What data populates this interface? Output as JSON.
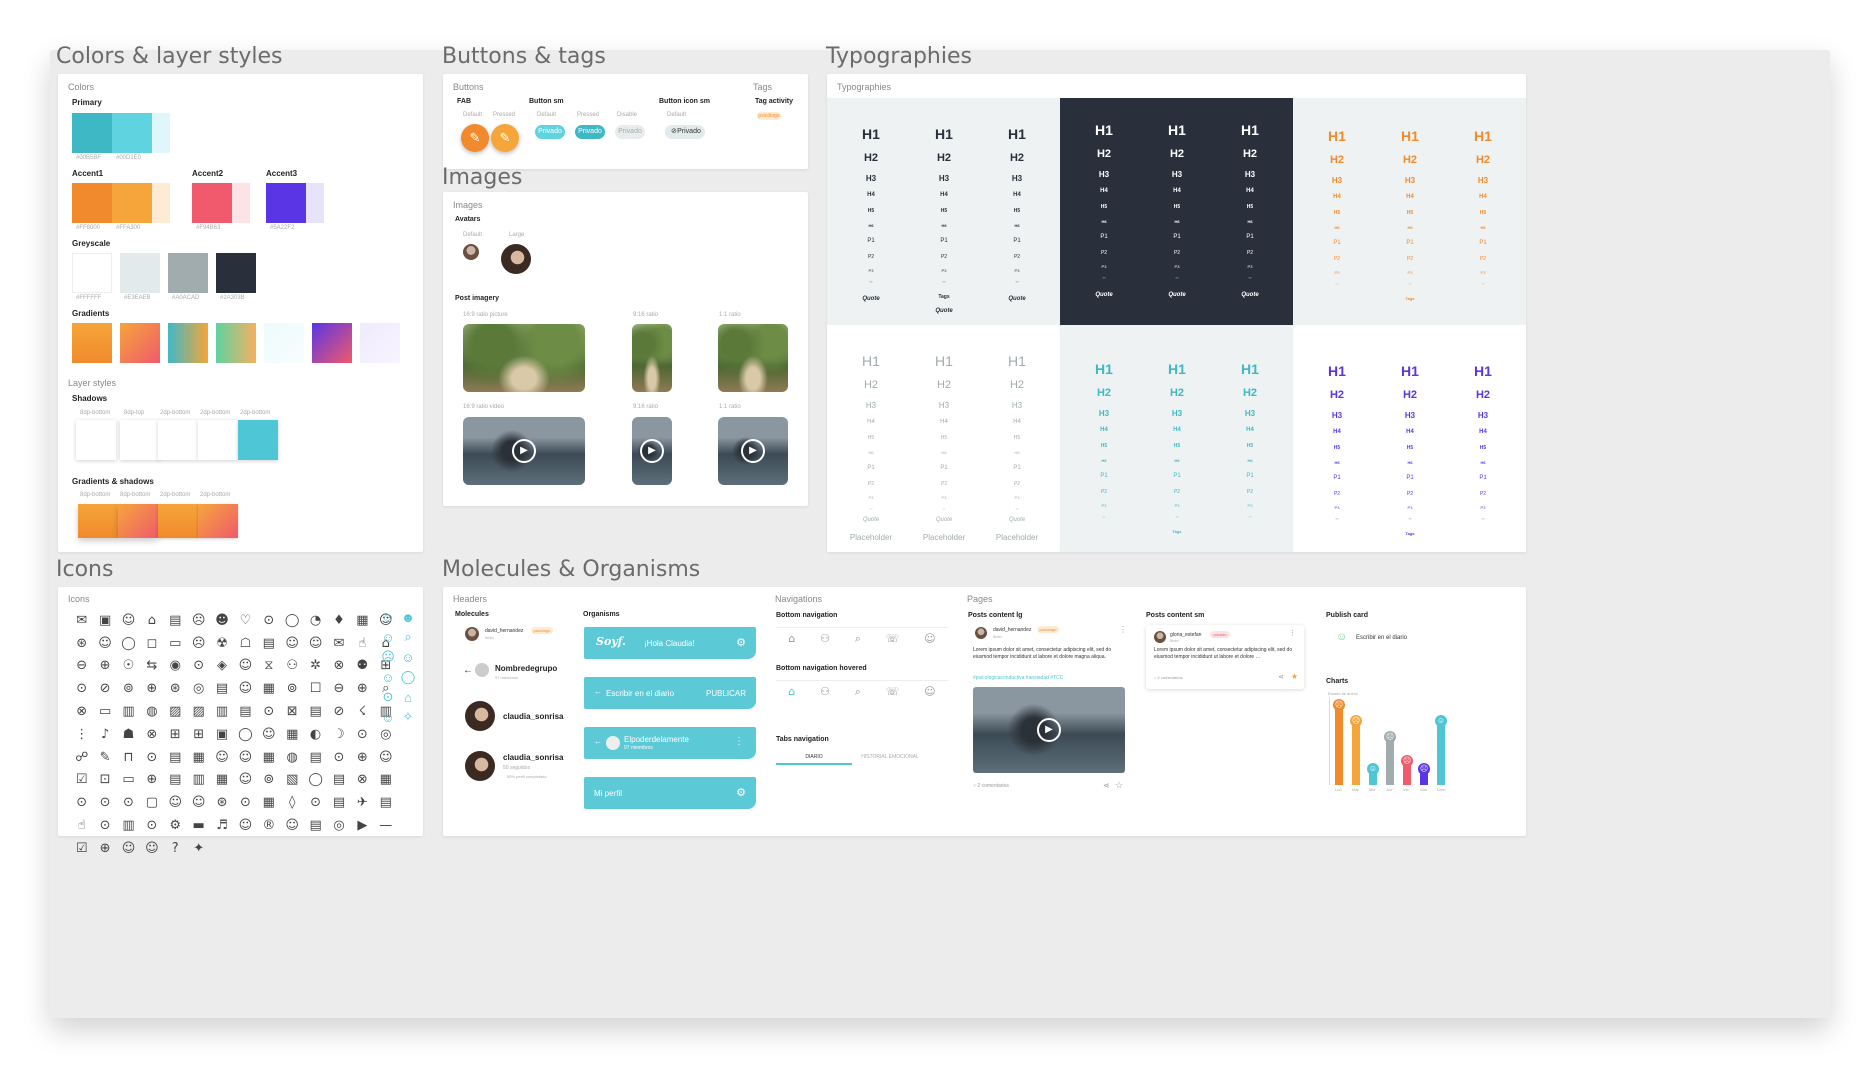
{
  "sections": {
    "colors": "Colors & layer styles",
    "buttons": "Buttons & tags",
    "images": "Images",
    "typographies": "Typographies",
    "icons": "Icons",
    "molecules": "Molecules & Organisms"
  },
  "colors": {
    "card_label": "Colors",
    "primary": "Primary",
    "primary_codes": [
      "#00B5BF",
      "#00D1E0"
    ],
    "accent1": "Accent1",
    "accent1_codes": [
      "#FF8000",
      "#FFA300"
    ],
    "accent2": "Accent2",
    "accent2_code": "#F94B63",
    "accent3": "Accent3",
    "accent3_code": "#5A22F2",
    "greyscale": "Greyscale",
    "grey_codes": [
      "#FFFFFF",
      "#E3EAEB",
      "#A0ACAD",
      "#2A303B"
    ],
    "gradients": "Gradients",
    "layer_styles": "Layer styles",
    "shadows": "Shadows",
    "shadow_labels": [
      "8dp-bottom",
      "8dp-top",
      "2dp-bottom",
      "2dp-bottom",
      "2dp-bottom"
    ],
    "grad_shadows": "Gradients & shadows",
    "grad_shadow_labels": [
      "8dp-bottom",
      "8dp-bottom",
      "2dp-bottom",
      "2dp-bottom"
    ],
    "swatch_colors": {
      "primary": [
        "#3fb8c6",
        "#5fd3e0",
        "#dff7fa"
      ],
      "accent1": [
        "#f08a2c",
        "#f5a53a",
        "#fdebd3"
      ],
      "accent2": [
        "#f05a6c",
        "#fde3e6"
      ],
      "accent3": [
        "#5a35e6",
        "#e7e3fb"
      ],
      "grey": [
        "#ffffff",
        "#e3eaeb",
        "#a0acad",
        "#2a303b"
      ]
    }
  },
  "buttons": {
    "card_label": "Buttons",
    "tags_label": "Tags",
    "fab": "FAB",
    "button_sm": "Button sm",
    "button_icon_sm": "Button icon sm",
    "tag_activity": "Tag activity",
    "states_fab": [
      "Default",
      "Pressed"
    ],
    "states_sm": [
      "Default",
      "Pressed",
      "Disable"
    ],
    "state_icon": "Default",
    "privado": "Privado",
    "tag_text": "psicólogo"
  },
  "images": {
    "card_label": "Images",
    "avatars": "Avatars",
    "avatar_states": [
      "Default",
      "Large"
    ],
    "post_imagery": "Post imagery",
    "ratios_top": [
      "16:9 ratio picture",
      "9:16 ratio",
      "1:1 ratio"
    ],
    "ratios_bottom": [
      "16:9 ratio video",
      "9:16 ratio",
      "1:1 ratio"
    ]
  },
  "typography": {
    "card_label": "Typographies",
    "levels": [
      "H1",
      "H2",
      "H3",
      "H4",
      "H5",
      "H6",
      "P1",
      "P2",
      "P3",
      "\"\""
    ],
    "quote": "Quote",
    "tags": "Tags",
    "placeholder": "Placeholder",
    "colors": {
      "dark": "#2a303b",
      "orange": "#f08a2c",
      "teal": "#3fb8c6",
      "purple": "#5a35e6",
      "grey": "#a0acad"
    }
  },
  "icons": {
    "card_label": "Icons",
    "glyphs": [
      "✉",
      "▣",
      "☺",
      "⌂",
      "▤",
      "☹",
      "☻",
      "♡",
      "⊙",
      "◯",
      "◔",
      "♦",
      "▦",
      "☺",
      "⊛",
      "☺",
      "◯",
      "◻",
      "▭",
      "☹",
      "☢",
      "☖",
      "▤",
      "☺",
      "☺",
      "✉",
      "☝",
      "⌂",
      "⊖",
      "⊕",
      "☉",
      "⇆",
      "◉",
      "⊙",
      "◈",
      "☺",
      "⧖",
      "⚇",
      "✲",
      "⊗",
      "⚉",
      "⊞",
      "⊙",
      "⊘",
      "⊚",
      "⊕",
      "⊛",
      "◎",
      "▤",
      "☺",
      "▦",
      "⊚",
      "☐",
      "⊖",
      "⊕",
      "⌕",
      "⊗",
      "▭",
      "▥",
      "◍",
      "▨",
      "▨",
      "▥",
      "▤",
      "⊙",
      "⊠",
      "▤",
      "⊘",
      "☇",
      "▥",
      "⋮",
      "♪",
      "☗",
      "⊗",
      "⊞",
      "⊞",
      "▣",
      "◯",
      "☺",
      "▦",
      "◐",
      "☽",
      "⊙",
      "◎",
      "☍",
      "✎",
      "⊓",
      "⊙",
      "▤",
      "▦",
      "☺",
      "☺",
      "▦",
      "◍",
      "▤",
      "⊙",
      "⊕",
      "☺",
      "☑",
      "⊡",
      "▭",
      "⊕",
      "▤",
      "▥",
      "▦",
      "☺",
      "⊚",
      "▧",
      "◯",
      "▤",
      "⊗",
      "▦",
      "⊙",
      "⊙",
      "⊙",
      "▢",
      "☺",
      "☺",
      "⊛",
      "⊙",
      "▦",
      "◊",
      "⊙",
      "▤",
      "✈",
      "▤",
      "☝",
      "⊙",
      "▥",
      "⊙",
      "⚙",
      "▬",
      "♬",
      "☺",
      "®",
      "☺",
      "▤",
      "◎",
      "▶",
      "—",
      "☑",
      "⊕",
      "☺",
      "☺",
      "?",
      "✦"
    ],
    "teal_glyphs": [
      "☺",
      "☻",
      "☺",
      "⌕",
      "☹",
      "☺",
      "☺",
      "◯",
      "⊙",
      "⌂",
      "☺",
      "✧"
    ]
  },
  "molecules": {
    "headers": "Headers",
    "molecules": "Molecules",
    "organisms": "Organisms",
    "user1": "david_hernandez",
    "user1_tag": "psicólogo",
    "user1_time": "5min",
    "group_name": "Nombredegrupo",
    "group_members": "97 miembros",
    "user2": "claudia_sonrisa",
    "user3": "claudia_sonrisa",
    "user3_follow": "50 seguidos",
    "user3_progress": "50% perfil completado",
    "org_logo": "Soyf.",
    "org_hello": "¡Hola Claudia!",
    "org_write": "Escribir en el diario",
    "org_publish": "PUBLICAR",
    "org_group": "Elpoderdelamente",
    "org_group_members": "97 miembros",
    "org_profile": "Mi perfil",
    "navigations": "Navigations",
    "bottom_nav": "Bottom navigation",
    "bottom_nav_hovered": "Bottom navigation hovered",
    "tabs_nav": "Tabs navigation",
    "tab1": "DIARIO",
    "tab2": "HISTORIAL EMOCIONAL",
    "pages": "Pages",
    "posts_lg": "Posts content lg",
    "posts_sm": "Posts content sm",
    "publish_card": "Publish card",
    "post_user": "david_hernandez",
    "post_tag": "psicólogo",
    "post_time": "5min",
    "post_text": "Lorem ipsum dolor sit amet, consectetur adipiscing elit, sed do eiusmod tempor incididunt ut labore et dolore magna aliqua.",
    "post_hashtags": "#psicológicaconductiva #ansiedad #TCC",
    "post_comments": "2 comentarios",
    "sm_user": "gloria_estefan",
    "sm_tag": "privado",
    "sm_time": "5min",
    "sm_text": "Lorem ipsum dolor sit amet, consectetur adipiscing elit, sed do eiusmod tempor incididunt ut labore et dolore …",
    "sm_comments": "2 comentarios",
    "publish_text": "Escribir en el diario",
    "charts": "Charts",
    "chart_caption": "Estado de ánimo",
    "chart_days": [
      "Lun",
      "Mar",
      "Mié",
      "Jue",
      "Vie",
      "Sáb",
      "Dom"
    ]
  },
  "chart_data": {
    "type": "bar",
    "categories": [
      "Lun",
      "Mar",
      "Mié",
      "Jue",
      "Vie",
      "Sáb",
      "Dom"
    ],
    "values": [
      5,
      4,
      1,
      3,
      1.5,
      1,
      4
    ],
    "ylim": [
      0,
      5
    ],
    "colors": [
      "#f08a2c",
      "#f5a53a",
      "#4ec6d5",
      "#a0acad",
      "#f05a6c",
      "#5a35e6",
      "#4ec6d5"
    ]
  }
}
